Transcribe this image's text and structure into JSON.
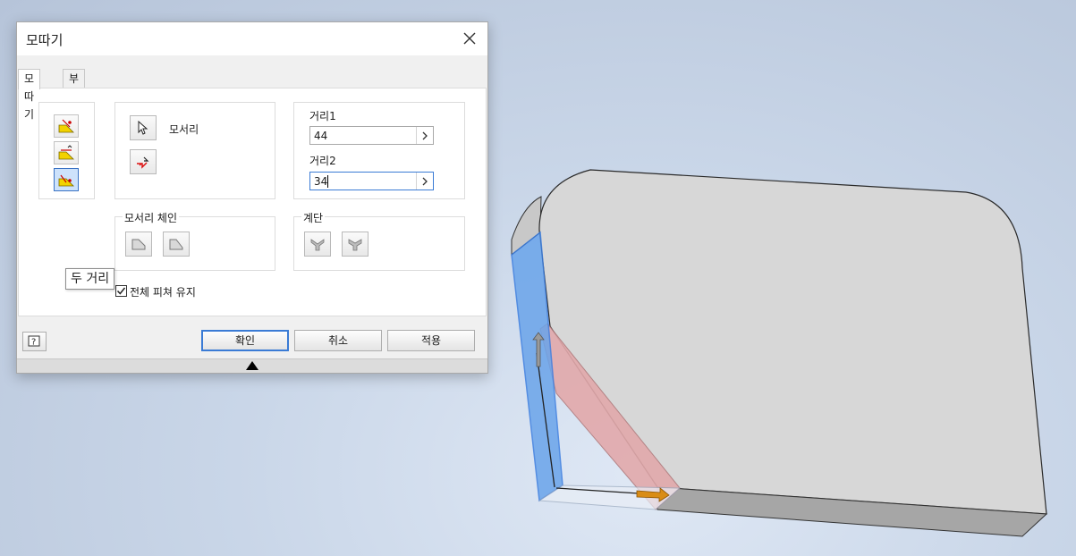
{
  "dialog": {
    "title": "모따기",
    "tabs": [
      {
        "label": "모따기",
        "active": true
      },
      {
        "label": "부분",
        "active": false
      }
    ],
    "method_buttons": [
      {
        "icon": "chamfer-distance-icon"
      },
      {
        "icon": "chamfer-distance-angle-icon"
      },
      {
        "icon": "chamfer-two-distances-icon",
        "selected": true
      }
    ],
    "tooltip": "두 거리",
    "edges": {
      "label": "모서리",
      "select_icon": "cursor-arrow-icon",
      "flip_icon": "flip-direction-icon"
    },
    "distance1": {
      "label": "거리1",
      "value": "44"
    },
    "distance2": {
      "label": "거리2",
      "value": "34"
    },
    "edge_chain": {
      "label": "모서리 체인"
    },
    "setback": {
      "label": "계단"
    },
    "preserve_all_features": {
      "label": "전체 피쳐 유지",
      "checked": true
    },
    "buttons": {
      "ok": "확인",
      "cancel": "취소",
      "apply": "적용"
    },
    "help_icon": "help-icon"
  },
  "colors": {
    "accent": "#3a7bd5",
    "face_blue": "#6aa4ea",
    "face_red": "#e2a9ab",
    "part_gray": "#d7d7d7",
    "arrow_orange": "#d98c16"
  }
}
